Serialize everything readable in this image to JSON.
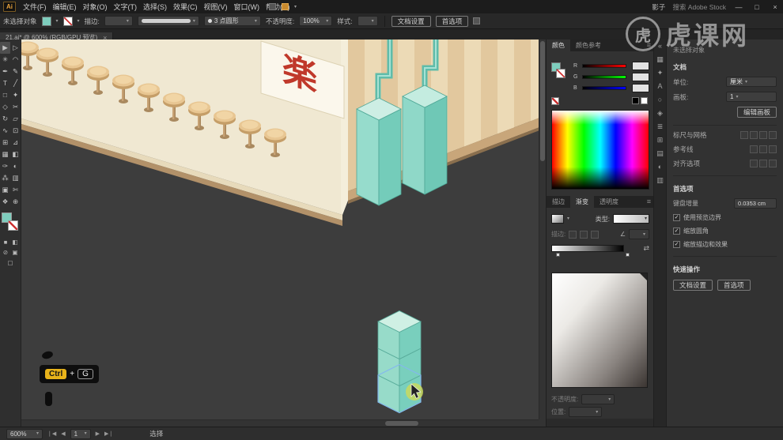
{
  "window": {
    "logo": "Ai",
    "menus": [
      "文件(F)",
      "编辑(E)",
      "对象(O)",
      "文字(T)",
      "选择(S)",
      "效果(C)",
      "视图(V)",
      "窗口(W)",
      "帮助(H)"
    ],
    "user": "影子",
    "search": "搜索 Adobe Stock",
    "controls": {
      "minimize": "—",
      "maximize": "□",
      "close": "×"
    }
  },
  "control_bar": {
    "no_selection": "未选择对象",
    "stroke_label": "描边:",
    "brush": "3 点圆形",
    "opacity_label": "不透明度:",
    "opacity_value": "100%",
    "style_label": "样式:",
    "doc_setup": "文档设置",
    "preferences": "首选项"
  },
  "document_tab": {
    "title": "21.ai* @ 600% (RGB/GPU 预览)",
    "close": "×"
  },
  "tools": [
    {
      "name": "selection-tool",
      "glyph": "▶"
    },
    {
      "name": "direct-selection-tool",
      "glyph": "▷"
    },
    {
      "name": "magic-wand-tool",
      "glyph": "✳"
    },
    {
      "name": "lasso-tool",
      "glyph": "◠"
    },
    {
      "name": "pen-tool",
      "glyph": "✒"
    },
    {
      "name": "curvature-tool",
      "glyph": "✎"
    },
    {
      "name": "type-tool",
      "glyph": "T"
    },
    {
      "name": "line-segment-tool",
      "glyph": "╱"
    },
    {
      "name": "rectangle-tool",
      "glyph": "□"
    },
    {
      "name": "paintbrush-tool",
      "glyph": "✦"
    },
    {
      "name": "shaper-tool",
      "glyph": "◇"
    },
    {
      "name": "eraser-tool",
      "glyph": "✂"
    },
    {
      "name": "rotate-tool",
      "glyph": "↻"
    },
    {
      "name": "scale-tool",
      "glyph": "▱"
    },
    {
      "name": "width-tool",
      "glyph": "∿"
    },
    {
      "name": "free-transform-tool",
      "glyph": "⊡"
    },
    {
      "name": "shape-builder-tool",
      "glyph": "⊞"
    },
    {
      "name": "perspective-grid-tool",
      "glyph": "⊿"
    },
    {
      "name": "mesh-tool",
      "glyph": "▦"
    },
    {
      "name": "gradient-tool",
      "glyph": "◧"
    },
    {
      "name": "eyedropper-tool",
      "glyph": "✑"
    },
    {
      "name": "blend-tool",
      "glyph": "◐"
    },
    {
      "name": "symbol-sprayer-tool",
      "glyph": "⁂"
    },
    {
      "name": "column-graph-tool",
      "glyph": "▥"
    },
    {
      "name": "artboard-tool",
      "glyph": "▣"
    },
    {
      "name": "slice-tool",
      "glyph": "✄"
    },
    {
      "name": "hand-tool",
      "glyph": "❖"
    },
    {
      "name": "zoom-tool",
      "glyph": "⊕"
    }
  ],
  "tool_footer": [
    {
      "name": "fill-color-icon",
      "glyph": "■"
    },
    {
      "name": "gradient-swatch-icon",
      "glyph": "◧"
    },
    {
      "name": "none-swatch-icon",
      "glyph": "⊘"
    },
    {
      "name": "draw-mode-icon",
      "glyph": "▣"
    },
    {
      "name": "screen-mode-icon",
      "glyph": "▢"
    }
  ],
  "canvas": {
    "sign_char": "楽",
    "shortcut": {
      "key": "Ctrl",
      "plus": "+",
      "key2": "G"
    }
  },
  "watermark": {
    "symbol": "虎",
    "text": "虎课网"
  },
  "panels": {
    "color": {
      "tabs": [
        "颜色",
        "颜色参考"
      ],
      "channels": [
        "R",
        "G",
        "B"
      ]
    },
    "gradient": {
      "tabs": [
        "描边",
        "渐变",
        "透明度"
      ],
      "type_label": "类型:",
      "stroke_label": "描边:",
      "opacity_label": "不透明度:",
      "location_label": "位置:"
    },
    "properties": {
      "header": "未选择对象",
      "document_section": "文档",
      "unit_label": "单位:",
      "unit_value": "厘米",
      "artboard_label": "画板:",
      "artboard_value": "1",
      "edit_artboard": "编辑画板",
      "rulers_label": "标尺与网格",
      "guides_label": "参考线",
      "snap_label": "对齐选项",
      "prefs_section": "首选项",
      "keyboard_increment_label": "键盘增量",
      "keyboard_increment_value": "0.0353 cm",
      "checkboxes": [
        {
          "label": "使用预览边界",
          "checked": true
        },
        {
          "label": "缩放圆角",
          "checked": true
        },
        {
          "label": "缩放描边和效果",
          "checked": true
        }
      ],
      "quick_actions": "快速操作",
      "quick_buttons": [
        "文档设置",
        "首选项"
      ]
    }
  },
  "icon_strip": [
    {
      "name": "collapse-dock-icon",
      "glyph": "«"
    },
    {
      "name": "swatches-icon",
      "glyph": "▦"
    },
    {
      "name": "brushes-icon",
      "glyph": "✦"
    },
    {
      "name": "character-icon",
      "glyph": "A"
    },
    {
      "name": "appearance-icon",
      "glyph": "○"
    },
    {
      "name": "graphic-styles-icon",
      "glyph": "◈"
    },
    {
      "name": "layers-icon",
      "glyph": "≣"
    },
    {
      "name": "artboards-icon",
      "glyph": "⊞"
    },
    {
      "name": "align-icon",
      "glyph": "▤"
    },
    {
      "name": "pathfinder-icon",
      "glyph": "◐"
    },
    {
      "name": "libraries-icon",
      "glyph": "▥"
    }
  ],
  "status_bar": {
    "zoom": "600%",
    "artboard": "1",
    "tool": "选择"
  },
  "icons": {
    "caret": "▾",
    "menu": "≡",
    "reverse": "⇄",
    "angle": "∠",
    "check": "✓",
    "nav_first": "❘◀",
    "nav_prev": "◀",
    "nav_next": "▶",
    "nav_last": "▶❘"
  },
  "colors": {
    "accent_teal": "#7ecdbd",
    "keycap_yellow": "#e8b31a",
    "sign_red": "#c0392b",
    "wood_tan": "#e8c692"
  }
}
